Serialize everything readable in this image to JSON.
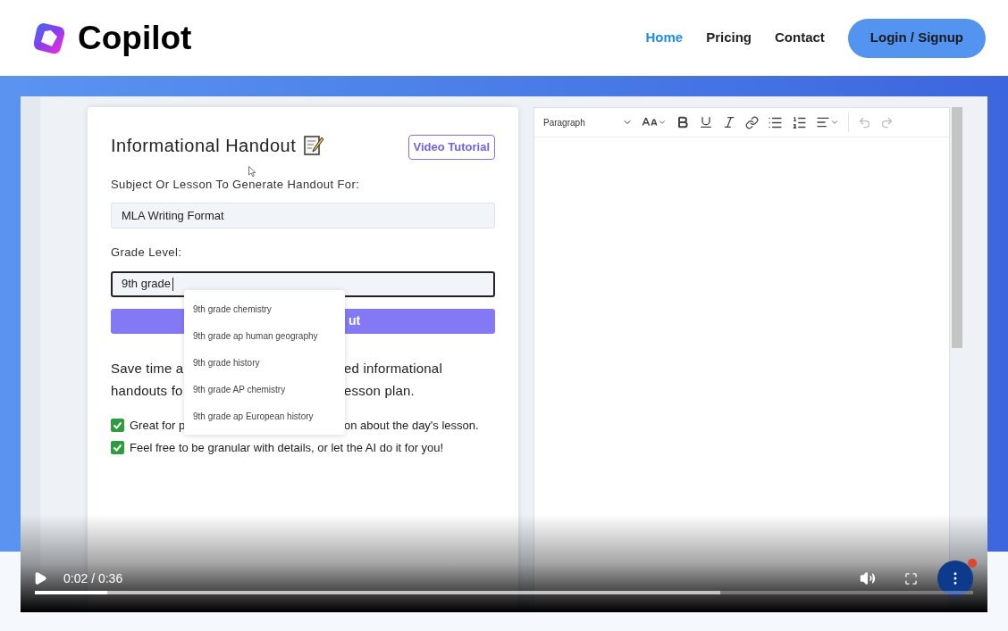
{
  "header": {
    "logo": "Copilot",
    "nav": [
      {
        "label": "Home",
        "selected": true
      },
      {
        "label": "Pricing",
        "selected": false
      },
      {
        "label": "Contact",
        "selected": false
      }
    ],
    "login_button": "Login / Signup"
  },
  "video": {
    "form": {
      "title": "Informational Handout",
      "tutorial_button": "Video Tutorial",
      "subject_label": "Subject Or Lesson To Generate Handout For:",
      "subject_value": "MLA Writing Format",
      "grade_label": "Grade Level:",
      "grade_value": "9th grade",
      "grade_focused": true,
      "submit_fragment": "ut",
      "suggestions": [
        "9th grade chemistry",
        "9th grade ap human geography",
        "9th grade history",
        "9th grade AP chemistry",
        "9th grade ap European history"
      ],
      "description_lines": [
        [
          "Save time a",
          "ed informational"
        ],
        [
          "handouts fo",
          "esson plan."
        ]
      ],
      "bullets": [
        {
          "checked": true,
          "parts": [
            "Great for p",
            "on about the day's lesson."
          ]
        },
        {
          "checked": true,
          "parts": [
            "Feel free to be granular with details, or let the AI do it for you!"
          ]
        }
      ]
    },
    "editor": {
      "block_style": "Paragraph"
    },
    "controls": {
      "playing": false,
      "time": "0:02 / 0:36",
      "progress": {
        "level": 0.077
      },
      "buffer": {
        "level": 0.73
      }
    }
  }
}
